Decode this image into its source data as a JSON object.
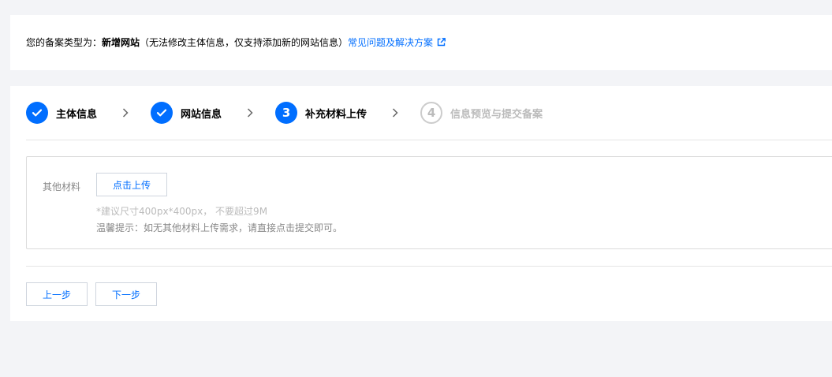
{
  "notice": {
    "prefix": "您的备案类型为：",
    "type": "新增网站",
    "note": "（无法修改主体信息，仅支持添加新的网站信息）",
    "link_text": "常见问题及解决方案",
    "link_icon": "external-link-icon"
  },
  "steps": [
    {
      "number": "1",
      "label": "主体信息",
      "status": "done",
      "icon": "check-icon"
    },
    {
      "number": "2",
      "label": "网站信息",
      "status": "done",
      "icon": "check-icon"
    },
    {
      "number": "3",
      "label": "补充材料上传",
      "status": "current"
    },
    {
      "number": "4",
      "label": "信息预览与提交备案",
      "status": "pending"
    }
  ],
  "upload": {
    "label": "其他材料",
    "button_label": "点击上传",
    "size_hint": "*建议尺寸400px*400px， 不要超过9M",
    "tip": "温馨提示：如无其他材料上传需求，请直接点击提交即可。"
  },
  "actions": {
    "prev_label": "上一步",
    "next_label": "下一步"
  },
  "colors": {
    "accent": "#006eff",
    "pending": "#bbbbbb",
    "background": "#f3f4f7"
  }
}
